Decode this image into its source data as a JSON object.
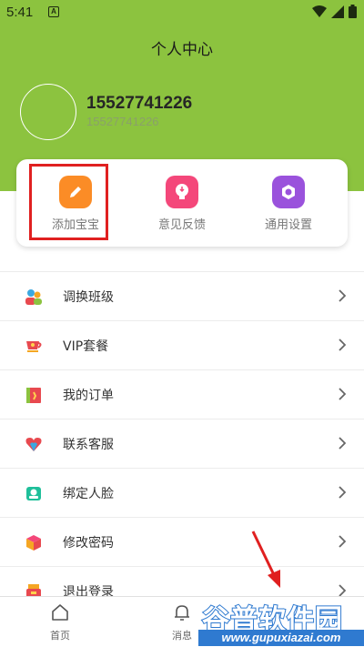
{
  "status_bar": {
    "time": "5:41",
    "notification_glyph": "A"
  },
  "header": {
    "title": "个人中心",
    "background": "#8cc33f"
  },
  "profile": {
    "name": "15527741226",
    "subtitle": "15527741226"
  },
  "actions": [
    {
      "label": "添加宝宝",
      "icon": "pencil-icon",
      "color": "#fb8c26"
    },
    {
      "label": "意见反馈",
      "icon": "lightbulb-icon",
      "color": "#f4477a"
    },
    {
      "label": "通用设置",
      "icon": "settings-icon",
      "color": "#9a52dc"
    }
  ],
  "menu": [
    {
      "label": "调换班级",
      "icon": "people-icon"
    },
    {
      "label": "VIP套餐",
      "icon": "cup-icon"
    },
    {
      "label": "我的订单",
      "icon": "order-book-icon"
    },
    {
      "label": "联系客服",
      "icon": "heart-service-icon"
    },
    {
      "label": "绑定人脸",
      "icon": "face-bind-icon"
    },
    {
      "label": "修改密码",
      "icon": "password-box-icon"
    },
    {
      "label": "退出登录",
      "icon": "logout-icon"
    }
  ],
  "bottom_nav": [
    {
      "label": "首页",
      "icon": "home-icon"
    },
    {
      "label": "消息",
      "icon": "bell-icon"
    }
  ],
  "watermark": {
    "text": "谷普软件园",
    "url": "www.gupuxiazai.com"
  },
  "accent_colors": {
    "highlight": "#e02020",
    "arrow": "#e02020"
  }
}
